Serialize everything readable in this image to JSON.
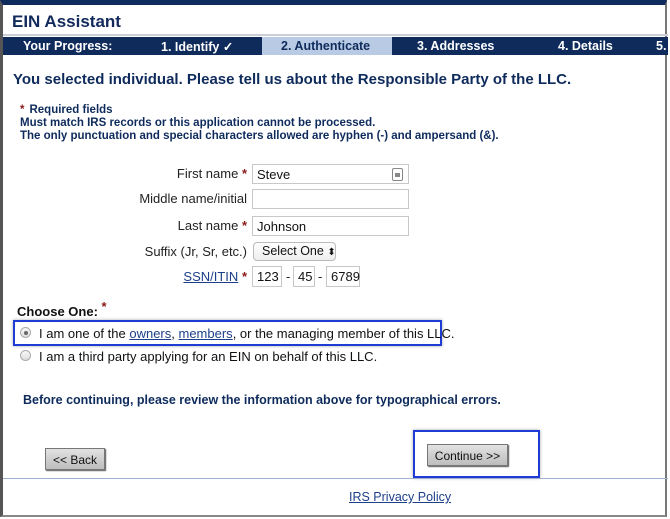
{
  "app": {
    "title": "EIN Assistant"
  },
  "progress": {
    "label": "Your Progress:",
    "steps": [
      {
        "label": "1. Identify ✓",
        "state": "completed"
      },
      {
        "label": "2. Authenticate",
        "state": "active"
      },
      {
        "label": "3. Addresses",
        "state": "pending"
      },
      {
        "label": "4. Details",
        "state": "pending"
      },
      {
        "label": "5.",
        "state": "pending"
      }
    ]
  },
  "heading": "You selected individual. Please tell us about the Responsible Party of the LLC.",
  "notes": {
    "required_star": "*",
    "required": "Required fields",
    "line1": "Must match IRS records or this application cannot be processed.",
    "line2": "The only punctuation and special characters allowed are hyphen (-) and ampersand (&)."
  },
  "form": {
    "first_name": {
      "label": "First name",
      "required": "*",
      "value": "Steve"
    },
    "middle_name": {
      "label": "Middle name/initial",
      "value": ""
    },
    "last_name": {
      "label": "Last name",
      "required": "*",
      "value": "Johnson"
    },
    "suffix": {
      "label": "Suffix (Jr, Sr, etc.)",
      "selected": "Select One",
      "arrow": "⬍"
    },
    "ssn": {
      "label": "SSN/ITIN",
      "required": "*",
      "part1": "123",
      "part2": "45",
      "part3": "6789",
      "sep": "-"
    }
  },
  "choose": {
    "label": "Choose One:",
    "required": "*",
    "option1": {
      "pre": "I am one of the ",
      "link1": "owners",
      "mid": ", ",
      "link2": "members",
      "post": ", or the managing member of this LLC.",
      "checked": true
    },
    "option2": {
      "text": "I am a third party applying for an EIN on behalf of this LLC.",
      "checked": false
    }
  },
  "review": "Before continuing, please review the information above for typographical errors.",
  "buttons": {
    "back": "<< Back",
    "continue": "Continue >>"
  },
  "footer": {
    "privacy": "IRS Privacy Policy"
  },
  "colors": {
    "navy": "#0e2b5c",
    "active_step": "#b9cbe4",
    "highlight": "#1f3bd6",
    "required": "#8b1a1a"
  }
}
